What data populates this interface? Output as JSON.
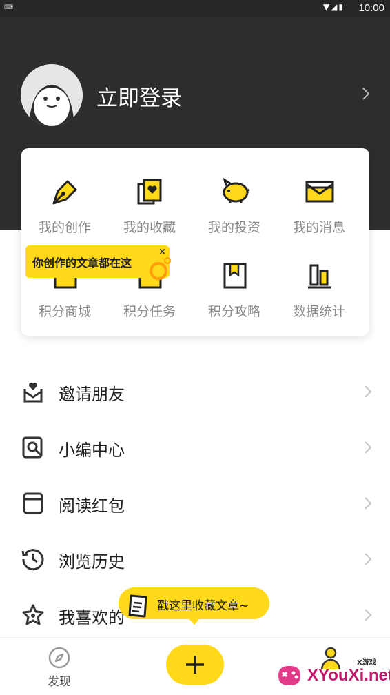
{
  "status_bar": {
    "keyboard_indicator": "⌨",
    "system_icons": "▼◢▮",
    "time": "10:00"
  },
  "header": {
    "login_label": "立即登录"
  },
  "grid": [
    {
      "label": "我的创作",
      "icon": "pen-nib-icon"
    },
    {
      "label": "我的收藏",
      "icon": "favorite-book-icon"
    },
    {
      "label": "我的投资",
      "icon": "piggy-bank-icon"
    },
    {
      "label": "我的消息",
      "icon": "envelope-icon"
    },
    {
      "label": "积分商城",
      "icon": "shopping-bag-icon"
    },
    {
      "label": "积分任务",
      "icon": "task-icon"
    },
    {
      "label": "积分攻略",
      "icon": "bookmark-book-icon"
    },
    {
      "label": "数据统计",
      "icon": "bar-chart-icon"
    }
  ],
  "tooltip_creation": {
    "text": "你创作的文章都在这",
    "close": "×"
  },
  "list": [
    {
      "label": "邀请朋友",
      "icon": "invite-icon"
    },
    {
      "label": "小编中心",
      "icon": "editor-search-icon"
    },
    {
      "label": "阅读红包",
      "icon": "red-envelope-icon"
    },
    {
      "label": "浏览历史",
      "icon": "history-clock-icon"
    },
    {
      "label": "我喜欢的",
      "icon": "star-icon"
    }
  ],
  "tooltip_favorites": {
    "text": "戳这里收藏文章~"
  },
  "tabbar": {
    "discover_label": "发现"
  },
  "watermark": {
    "small": "X游戏",
    "text": "XYouXi.net"
  },
  "colors": {
    "header_bg": "#2d2d2d",
    "accent_yellow": "#ffd91a",
    "accent_orange": "#ff9d0a",
    "watermark_pink": "#c2186a"
  }
}
